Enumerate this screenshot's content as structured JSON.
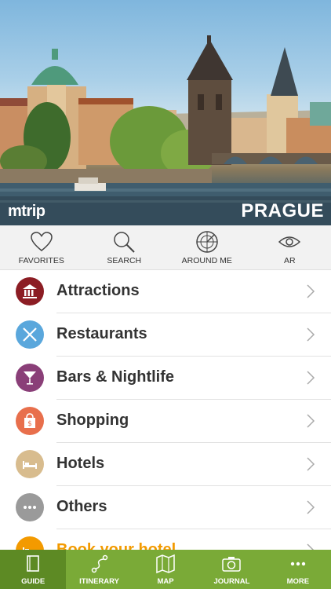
{
  "hero": {
    "brand": "mtrip",
    "city": "PRAGUE"
  },
  "quick_actions": [
    {
      "label": "FAVORITES",
      "icon": "heart-icon"
    },
    {
      "label": "SEARCH",
      "icon": "search-icon"
    },
    {
      "label": "AROUND ME",
      "icon": "radar-icon"
    },
    {
      "label": "AR",
      "icon": "eye-icon"
    }
  ],
  "categories": [
    {
      "label": "Attractions",
      "icon": "museum-icon",
      "color": "#8c1d24"
    },
    {
      "label": "Restaurants",
      "icon": "fork-knife-icon",
      "color": "#5aa7dc"
    },
    {
      "label": "Bars & Nightlife",
      "icon": "cocktail-icon",
      "color": "#8a3f78"
    },
    {
      "label": "Shopping",
      "icon": "shopping-bag-icon",
      "color": "#e86f4c"
    },
    {
      "label": "Hotels",
      "icon": "bed-icon",
      "color": "#d8bc8e"
    },
    {
      "label": "Others",
      "icon": "dots-icon",
      "color": "#9a9a9a"
    },
    {
      "label": "Book your hotel",
      "icon": "bed-icon",
      "color": "#f39a00"
    }
  ],
  "tabs": [
    {
      "label": "GUIDE",
      "icon": "book-icon",
      "active": true
    },
    {
      "label": "ITINERARY",
      "icon": "route-icon",
      "active": false
    },
    {
      "label": "MAP",
      "icon": "map-icon",
      "active": false
    },
    {
      "label": "JOURNAL",
      "icon": "camera-icon",
      "active": false
    },
    {
      "label": "MORE",
      "icon": "more-dots-icon",
      "active": false
    }
  ],
  "colors": {
    "tabbar": "#7aaa37",
    "tab_active": "#5d8a24",
    "book_accent": "#f39a00"
  }
}
